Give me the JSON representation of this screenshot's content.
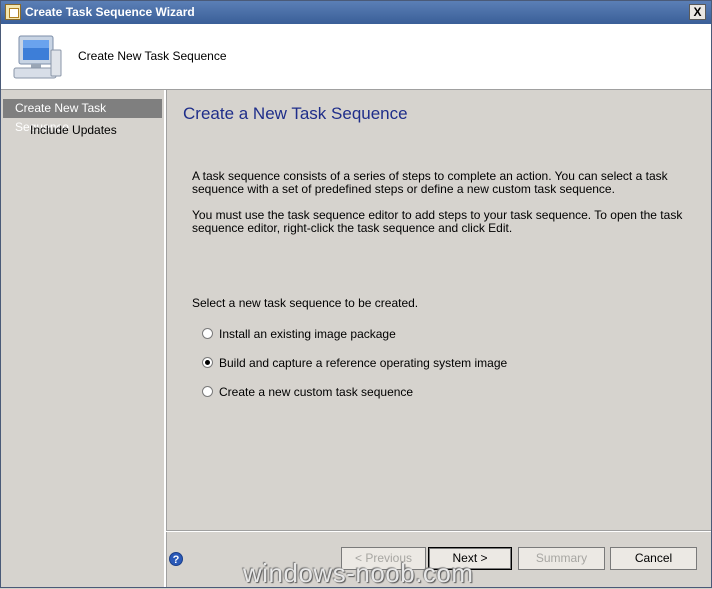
{
  "window": {
    "title": "Create Task Sequence Wizard",
    "close_glyph": "X"
  },
  "header": {
    "title": "Create New Task Sequence"
  },
  "sidebar": {
    "items": [
      {
        "label": "Create New Task Sequence"
      },
      {
        "label": "Include Updates"
      }
    ]
  },
  "main": {
    "page_title": "Create a New Task Sequence",
    "description": "A task sequence consists of a series of steps to complete an action. You can select a task sequence with a set of predefined steps or define a new custom task sequence.",
    "instructions": "You must use the task sequence editor to add steps to your task sequence. To open the task sequence editor, right-click the task sequence and click Edit.",
    "select_label": "Select a new task sequence to be created.",
    "options": [
      {
        "label": "Install an existing image package",
        "selected": false
      },
      {
        "label": "Build and capture a reference operating system image",
        "selected": true
      },
      {
        "label": "Create a new custom task sequence",
        "selected": false
      }
    ]
  },
  "footer": {
    "help_glyph": "?",
    "previous_label": "< Previous",
    "next_label": "Next >",
    "summary_label": "Summary",
    "cancel_label": "Cancel"
  },
  "watermark": "windows-noob.com"
}
